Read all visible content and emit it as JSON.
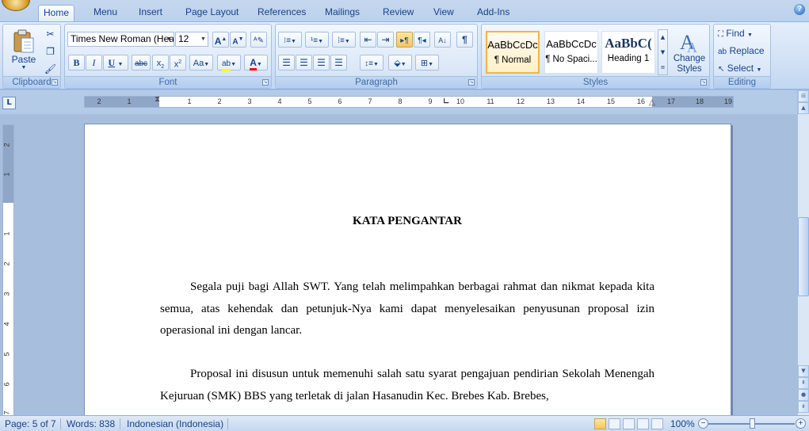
{
  "tabs": [
    "Home",
    "Menu",
    "Insert",
    "Page Layout",
    "References",
    "Mailings",
    "Review",
    "View",
    "Add-Ins"
  ],
  "active_tab": "Home",
  "clipboard": {
    "paste_label": "Paste",
    "group_label": "Clipboard"
  },
  "font": {
    "family_value": "Times New Roman (Hea",
    "size_value": "12",
    "group_label": "Font"
  },
  "paragraph": {
    "group_label": "Paragraph"
  },
  "styles": {
    "group_label": "Styles",
    "items": [
      {
        "sample": "AaBbCcDc",
        "name": "¶ Normal"
      },
      {
        "sample": "AaBbCcDc",
        "name": "¶ No Spaci..."
      },
      {
        "sample": "AaBbC(",
        "name": "Heading 1"
      }
    ],
    "change_styles_label": "Change Styles"
  },
  "editing": {
    "group_label": "Editing",
    "find_label": "Find",
    "replace_label": "Replace",
    "select_label": "Select"
  },
  "ruler": {
    "h_ticks": [
      "2",
      "1",
      "1",
      "2",
      "3",
      "4",
      "5",
      "6",
      "7",
      "8",
      "9",
      "10",
      "11",
      "12",
      "13",
      "14",
      "15",
      "16",
      "17",
      "18",
      "19"
    ],
    "v_ticks": [
      "2",
      "1",
      "1",
      "2",
      "3",
      "4",
      "5",
      "6",
      "7"
    ]
  },
  "document": {
    "title": "KATA PENGANTAR",
    "paragraph1": "Segala puji bagi Allah SWT. Yang telah melimpahkan berbagai rahmat dan nikmat kepada kita semua, atas kehendak dan petunjuk-Nya kami dapat menyelesaikan penyusunan proposal izin operasional ini dengan lancar.",
    "paragraph2": "Proposal ini disusun untuk memenuhi salah satu syarat pengajuan pendirian Sekolah Menengah Kejuruan (SMK) BBS yang terletak di jalan Hasanudin Kec. Brebes Kab. Brebes,"
  },
  "status": {
    "page": "Page: 5 of 7",
    "words": "Words: 838",
    "language": "Indonesian (Indonesia)",
    "zoom": "100%"
  },
  "colors": {
    "highlight": "#ffff00",
    "font_color": "#ff0000",
    "ribbon_text": "#15428b"
  }
}
